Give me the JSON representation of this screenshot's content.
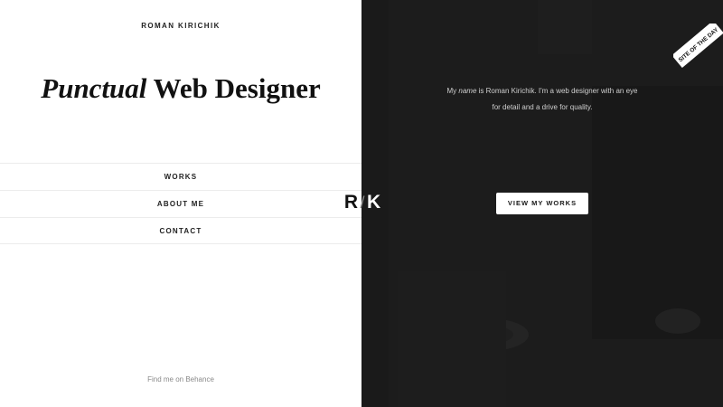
{
  "author": {
    "name": "ROMAN KIRICHIK"
  },
  "headline": {
    "italic": "Punctual",
    "rest": " Web Designer"
  },
  "nav": {
    "items": [
      {
        "label": "WORKS"
      },
      {
        "label": "ABOUT ME"
      },
      {
        "label": "CONTACT"
      }
    ]
  },
  "footer": {
    "behance_link": "Find me on Behance"
  },
  "logo": {
    "left": "R",
    "separator": "/",
    "right": "K"
  },
  "intro": {
    "before": "My ",
    "italic": "name",
    "after": " is Roman Kirichik. I'm a web designer with an eye for detail and a drive for quality."
  },
  "cta": {
    "label": "VIEW MY WORKS"
  },
  "badge": {
    "text": "SITE OF THE DAY",
    "icon": "site-of-the-day-badge"
  },
  "colors": {
    "dark_panel": "#1c1c1c",
    "light_panel": "#ffffff",
    "accent_button": "#ffffff"
  }
}
